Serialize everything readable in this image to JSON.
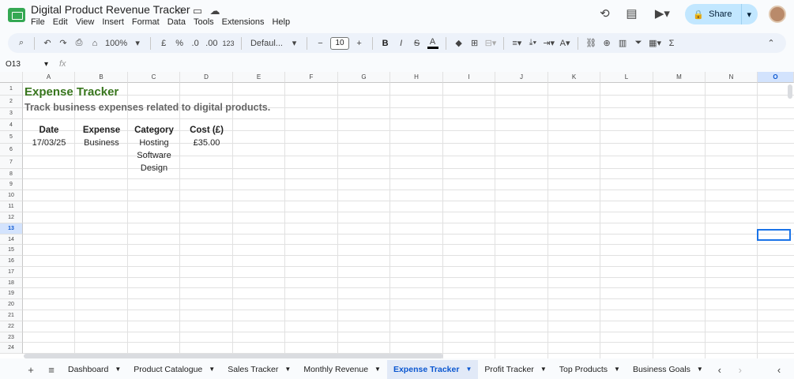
{
  "document": {
    "title": "Digital Product Revenue Tracker"
  },
  "title_icons": [
    "star-icon",
    "move-folder-icon",
    "cloud-status-icon"
  ],
  "menu": [
    "File",
    "Edit",
    "View",
    "Insert",
    "Format",
    "Data",
    "Tools",
    "Extensions",
    "Help"
  ],
  "header_actions": {
    "share_label": "Share"
  },
  "toolbar": {
    "zoom": "100%",
    "currency": "£",
    "percent": "%",
    "decrease_decimals": ".0",
    "increase_decimals": ".00",
    "more_formats": "123",
    "font": "Defaul...",
    "font_size": "10",
    "minus": "−",
    "plus": "+",
    "bold": "B",
    "italic": "I",
    "strike": "S",
    "text_color": "A",
    "sum": "Σ"
  },
  "formula_bar": {
    "name_box": "O13",
    "fx": "fx",
    "content": ""
  },
  "columns": [
    "A",
    "B",
    "C",
    "D",
    "E",
    "F",
    "G",
    "H",
    "I",
    "J",
    "K",
    "L",
    "M",
    "N",
    "O"
  ],
  "selected_column": "O",
  "rows": [
    "1",
    "2",
    "3",
    "4",
    "5",
    "6",
    "7",
    "8",
    "9",
    "10",
    "11",
    "12",
    "13",
    "14",
    "15",
    "16",
    "17",
    "18",
    "19",
    "20",
    "21",
    "22",
    "23",
    "24"
  ],
  "selected_row": "13",
  "cells": {
    "a1": "Expense Tracker",
    "a2": "Track business expenses related to digital products.",
    "a4": "Date",
    "b4": "Expense",
    "c4": "Category",
    "d4": "Cost (£)",
    "a5": "17/03/25",
    "b5": "Business",
    "c5": "Hosting",
    "d5": "£35.00",
    "c6": "Software",
    "c7": "Design"
  },
  "colors": {
    "title_green": "#38761d",
    "subtitle_gray": "#666666",
    "accent_blue": "#0b57d0",
    "share_bg": "#c2e7ff"
  },
  "sheets": [
    "Dashboard",
    "Product Catalogue",
    "Sales Tracker",
    "Monthly Revenue",
    "Expense Tracker",
    "Profit Tracker",
    "Top Products",
    "Business Goals"
  ],
  "active_sheet": "Expense Tracker"
}
